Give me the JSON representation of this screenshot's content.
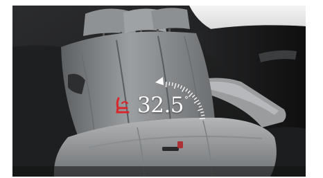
{
  "recline_angle": {
    "value": "32.5",
    "unit_symbol": "°",
    "icon": "seat-recline-icon",
    "accent_color": "#d8262b"
  },
  "scene": {
    "subject": "rear-bench-seat-photo",
    "colors": {
      "leather": "#8a8d8f",
      "leather_dark": "#3a3c3e",
      "trim_black": "#151515",
      "window_light": "#e9e9e9"
    }
  }
}
